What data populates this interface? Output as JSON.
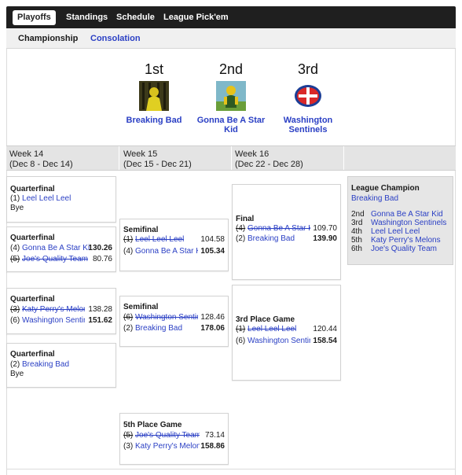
{
  "topnav": {
    "tabs": [
      {
        "label": "Playoffs",
        "active": true
      },
      {
        "label": "Standings",
        "active": false
      },
      {
        "label": "Schedule",
        "active": false
      },
      {
        "label": "League Pick'em",
        "active": false
      }
    ]
  },
  "subnav": {
    "tabs": [
      {
        "label": "Championship",
        "active": true
      },
      {
        "label": "Consolation",
        "active": false
      }
    ]
  },
  "podium": [
    {
      "place": "1st",
      "team": "Breaking Bad",
      "logo": "yellow-figure-logo"
    },
    {
      "place": "2nd",
      "team": "Gonna Be A Star Kid",
      "logo": "green-figure-logo"
    },
    {
      "place": "3rd",
      "team": "Washington Sentinels",
      "logo": "helmet-logo"
    }
  ],
  "weeks": [
    {
      "name": "Week 14",
      "range": "(Dec 8 - Dec 14)"
    },
    {
      "name": "Week 15",
      "range": "(Dec 15 - Dec 21)"
    },
    {
      "name": "Week 16",
      "range": "(Dec 22 - Dec 28)"
    }
  ],
  "matches": {
    "qf1": {
      "title": "Quarterfinal",
      "team1": {
        "seed": "(1)",
        "name": "Leel Leel Leel"
      },
      "bye": "Bye"
    },
    "qf2": {
      "title": "Quarterfinal",
      "team1": {
        "seed": "(4)",
        "name": "Gonna Be A Star Kid",
        "score": "130.26"
      },
      "team2": {
        "seed": "(5)",
        "name": "Joe's Quality Team",
        "score": "80.76"
      }
    },
    "qf3": {
      "title": "Quarterfinal",
      "team1": {
        "seed": "(3)",
        "name": "Katy Perry's Melons",
        "score": "138.28"
      },
      "team2": {
        "seed": "(6)",
        "name": "Washington Sentinels",
        "score": "151.62"
      }
    },
    "qf4": {
      "title": "Quarterfinal",
      "team1": {
        "seed": "(2)",
        "name": "Breaking Bad"
      },
      "bye": "Bye"
    },
    "sf1": {
      "title": "Semifinal",
      "team1": {
        "seed": "(1)",
        "name": "Leel Leel Leel",
        "score": "104.58"
      },
      "team2": {
        "seed": "(4)",
        "name": "Gonna Be A Star Kid",
        "score": "105.34"
      }
    },
    "sf2": {
      "title": "Semifinal",
      "team1": {
        "seed": "(6)",
        "name": "Washington Sentinels",
        "score": "128.46"
      },
      "team2": {
        "seed": "(2)",
        "name": "Breaking Bad",
        "score": "178.06"
      }
    },
    "fifth": {
      "title": "5th Place Game",
      "team1": {
        "seed": "(5)",
        "name": "Joe's Quality Team",
        "score": "73.14"
      },
      "team2": {
        "seed": "(3)",
        "name": "Katy Perry's Melons",
        "score": "158.86"
      }
    },
    "final": {
      "title": "Final",
      "team1": {
        "seed": "(4)",
        "name": "Gonna Be A Star Kid",
        "score": "109.70"
      },
      "team2": {
        "seed": "(2)",
        "name": "Breaking Bad",
        "score": "139.90"
      }
    },
    "third": {
      "title": "3rd Place Game",
      "team1": {
        "seed": "(1)",
        "name": "Leel Leel Leel",
        "score": "120.44"
      },
      "team2": {
        "seed": "(6)",
        "name": "Washington Sentinels",
        "score": "158.54"
      }
    }
  },
  "champion": {
    "title": "League Champion",
    "name": "Breaking Bad",
    "rankings": [
      {
        "rank": "2nd",
        "team": "Gonna Be A Star Kid"
      },
      {
        "rank": "3rd",
        "team": "Washington Sentinels"
      },
      {
        "rank": "4th",
        "team": "Leel Leel Leel"
      },
      {
        "rank": "5th",
        "team": "Katy Perry's Melons"
      },
      {
        "rank": "6th",
        "team": "Joe's Quality Team"
      }
    ]
  },
  "colors": {
    "link": "#2a3fc4",
    "nav_bg": "#1f1f1f",
    "week_bar": "#e4e4e4"
  }
}
